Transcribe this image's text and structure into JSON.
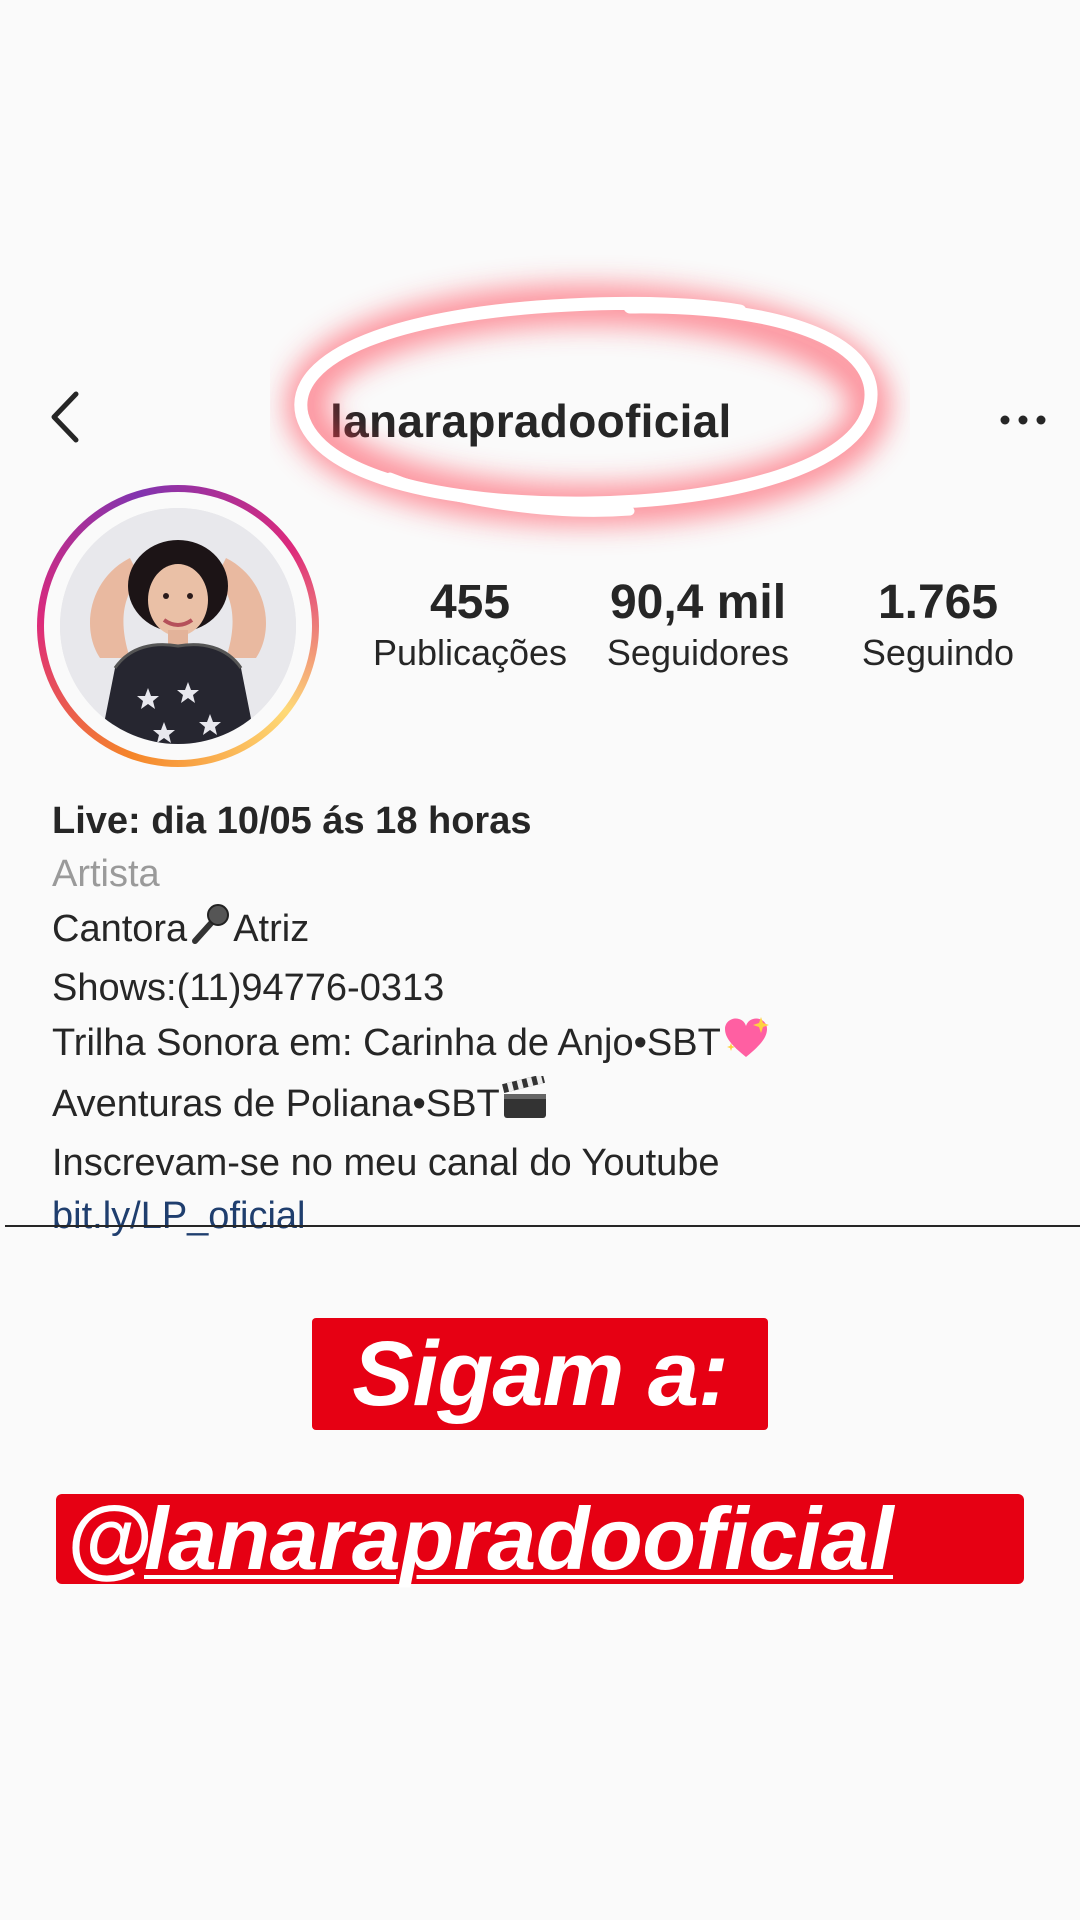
{
  "header": {
    "username": "lanarapradooficial",
    "back_icon": "chevron-left-icon",
    "more_icon": "more-horizontal-icon"
  },
  "stats": [
    {
      "value": "455",
      "label": "Publicações"
    },
    {
      "value": "90,4 mil",
      "label": "Seguidores"
    },
    {
      "value": "1.765",
      "label": "Seguindo"
    }
  ],
  "bio": {
    "name": "Live: dia 10/05 ás 18 horas",
    "category": "Artista",
    "line1": "Cantora",
    "line1_after": "Atriz",
    "line2": "Shows:(11)94776-0313",
    "line3": "Trilha Sonora em: Carinha de Anjo•SBT",
    "line4": "Aventuras de Poliana•SBT",
    "line5": "Inscrevam-se no meu canal do Youtube",
    "link": "bit.ly/LP_oficial"
  },
  "stickers": {
    "follow_text": "Sigam a:",
    "at": "@",
    "handle": "lanarapradooficial"
  },
  "colors": {
    "accent_red": "#e60013",
    "link_blue": "#1f3e6e",
    "highlight_glow": "#ff3b4e"
  }
}
